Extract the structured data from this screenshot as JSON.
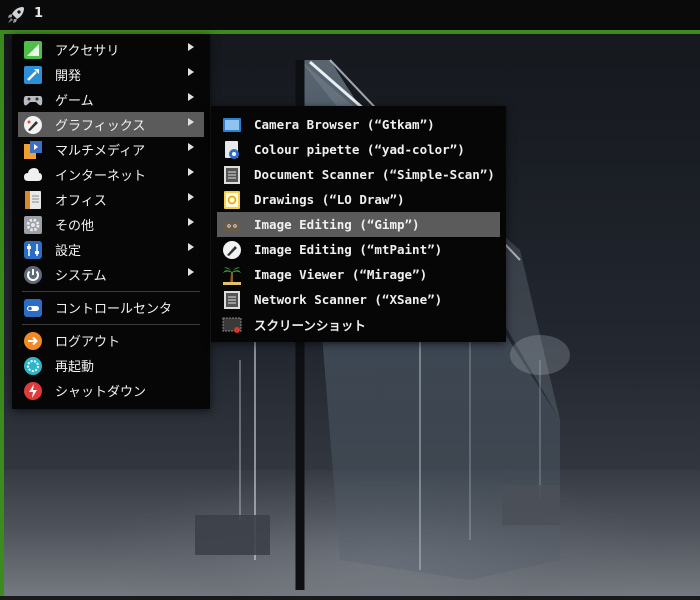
{
  "panel": {
    "workspace": "1",
    "launcher_icon": "rocket-icon"
  },
  "main_menu": {
    "categories": [
      {
        "label": "アクセサリ",
        "icon": "accessories-icon",
        "has_submenu": true
      },
      {
        "label": "開発",
        "icon": "development-icon",
        "has_submenu": true
      },
      {
        "label": "ゲーム",
        "icon": "gamepad-icon",
        "has_submenu": true
      },
      {
        "label": "グラフィックス",
        "icon": "graphics-icon",
        "has_submenu": true,
        "active": true
      },
      {
        "label": "マルチメディア",
        "icon": "multimedia-icon",
        "has_submenu": true
      },
      {
        "label": "インターネット",
        "icon": "cloud-icon",
        "has_submenu": true
      },
      {
        "label": "オフィス",
        "icon": "office-icon",
        "has_submenu": true
      },
      {
        "label": "その他",
        "icon": "gear-icon",
        "has_submenu": true
      },
      {
        "label": "設定",
        "icon": "settings-icon",
        "has_submenu": true
      },
      {
        "label": "システム",
        "icon": "power-icon",
        "has_submenu": true
      }
    ],
    "control_center": {
      "label": "コントロールセンタ",
      "icon": "toggle-icon"
    },
    "session": [
      {
        "label": "ログアウト",
        "icon": "logout-icon",
        "color": "#f08a24"
      },
      {
        "label": "再起動",
        "icon": "reboot-icon",
        "color": "#2fb5c9"
      },
      {
        "label": "シャットダウン",
        "icon": "shutdown-icon",
        "color": "#e03b3b"
      }
    ]
  },
  "graphics_submenu": {
    "items": [
      {
        "label": "Camera Browser (“Gtkam”)",
        "icon": "camera-browser-icon"
      },
      {
        "label": "Colour pipette (“yad-color”)",
        "icon": "color-pipette-icon"
      },
      {
        "label": "Document Scanner (“Simple-Scan”)",
        "icon": "document-scanner-icon"
      },
      {
        "label": "Drawings (“LO Draw”)",
        "icon": "drawing-icon"
      },
      {
        "label": "Image Editing (“Gimp”)",
        "icon": "gimp-icon",
        "active": true
      },
      {
        "label": "Image Editing (“mtPaint”)",
        "icon": "paint-icon"
      },
      {
        "label": "Image Viewer (“Mirage”)",
        "icon": "palm-tree-icon"
      },
      {
        "label": "Network Scanner (“XSane”)",
        "icon": "scanner-icon"
      },
      {
        "label": "スクリーンショット",
        "icon": "screenshot-icon"
      }
    ]
  },
  "colors": {
    "accent_border": "#3d8a1f",
    "menu_bg": "#060606",
    "highlight": "#5b5b5b"
  }
}
